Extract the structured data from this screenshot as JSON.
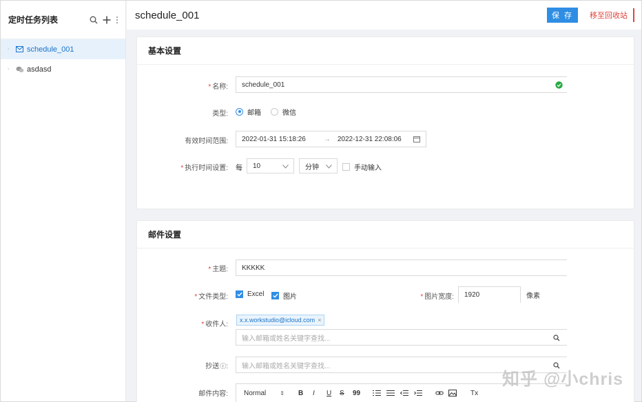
{
  "sidebar": {
    "title": "定时任务列表",
    "items": [
      {
        "label": "schedule_001",
        "icon": "mail-icon",
        "active": true
      },
      {
        "label": "asdasd",
        "icon": "wechat-icon",
        "active": false
      }
    ]
  },
  "header": {
    "title": "schedule_001",
    "save_label": "保 存",
    "recycle_label": "移至回收站"
  },
  "basic": {
    "section_title": "基本设置",
    "name_label": "名称:",
    "name_value": "schedule_001",
    "type_label": "类型:",
    "type_options": [
      "邮箱",
      "微信"
    ],
    "type_selected": "邮箱",
    "range_label": "有效时间范围:",
    "range_start": "2022-01-31 15:18:26",
    "range_sep": "→",
    "range_end": "2022-12-31 22:08:06",
    "exec_label": "执行时间设置:",
    "exec_every": "每",
    "exec_value": "10",
    "exec_unit": "分钟",
    "manual_label": "手动输入"
  },
  "mail": {
    "section_title": "邮件设置",
    "subject_label": "主题:",
    "subject_value": "KKKKK",
    "filetype_label": "文件类型:",
    "filetype_excel": "Excel",
    "filetype_image": "图片",
    "img_width_label": "图片宽度:",
    "img_width_value": "1920",
    "img_width_unit": "像素",
    "recipient_label": "收件人:",
    "recipient_tag": "x.x.workstudio@icloud.com",
    "recipient_placeholder": "输入邮箱或姓名关键字查找...",
    "cc_label": "抄送",
    "cc_placeholder": "输入邮箱或姓名关键字查找...",
    "content_label": "邮件内容:",
    "toolbar": {
      "format": "Normal",
      "bold": "B",
      "italic": "I",
      "underline": "U",
      "strike": "S",
      "quote": "99",
      "clear": "Tx"
    }
  },
  "watermark": "知乎 @小chris",
  "colors": {
    "accent": "#2f8ee3",
    "danger": "#e0443d",
    "success": "#27a844"
  }
}
